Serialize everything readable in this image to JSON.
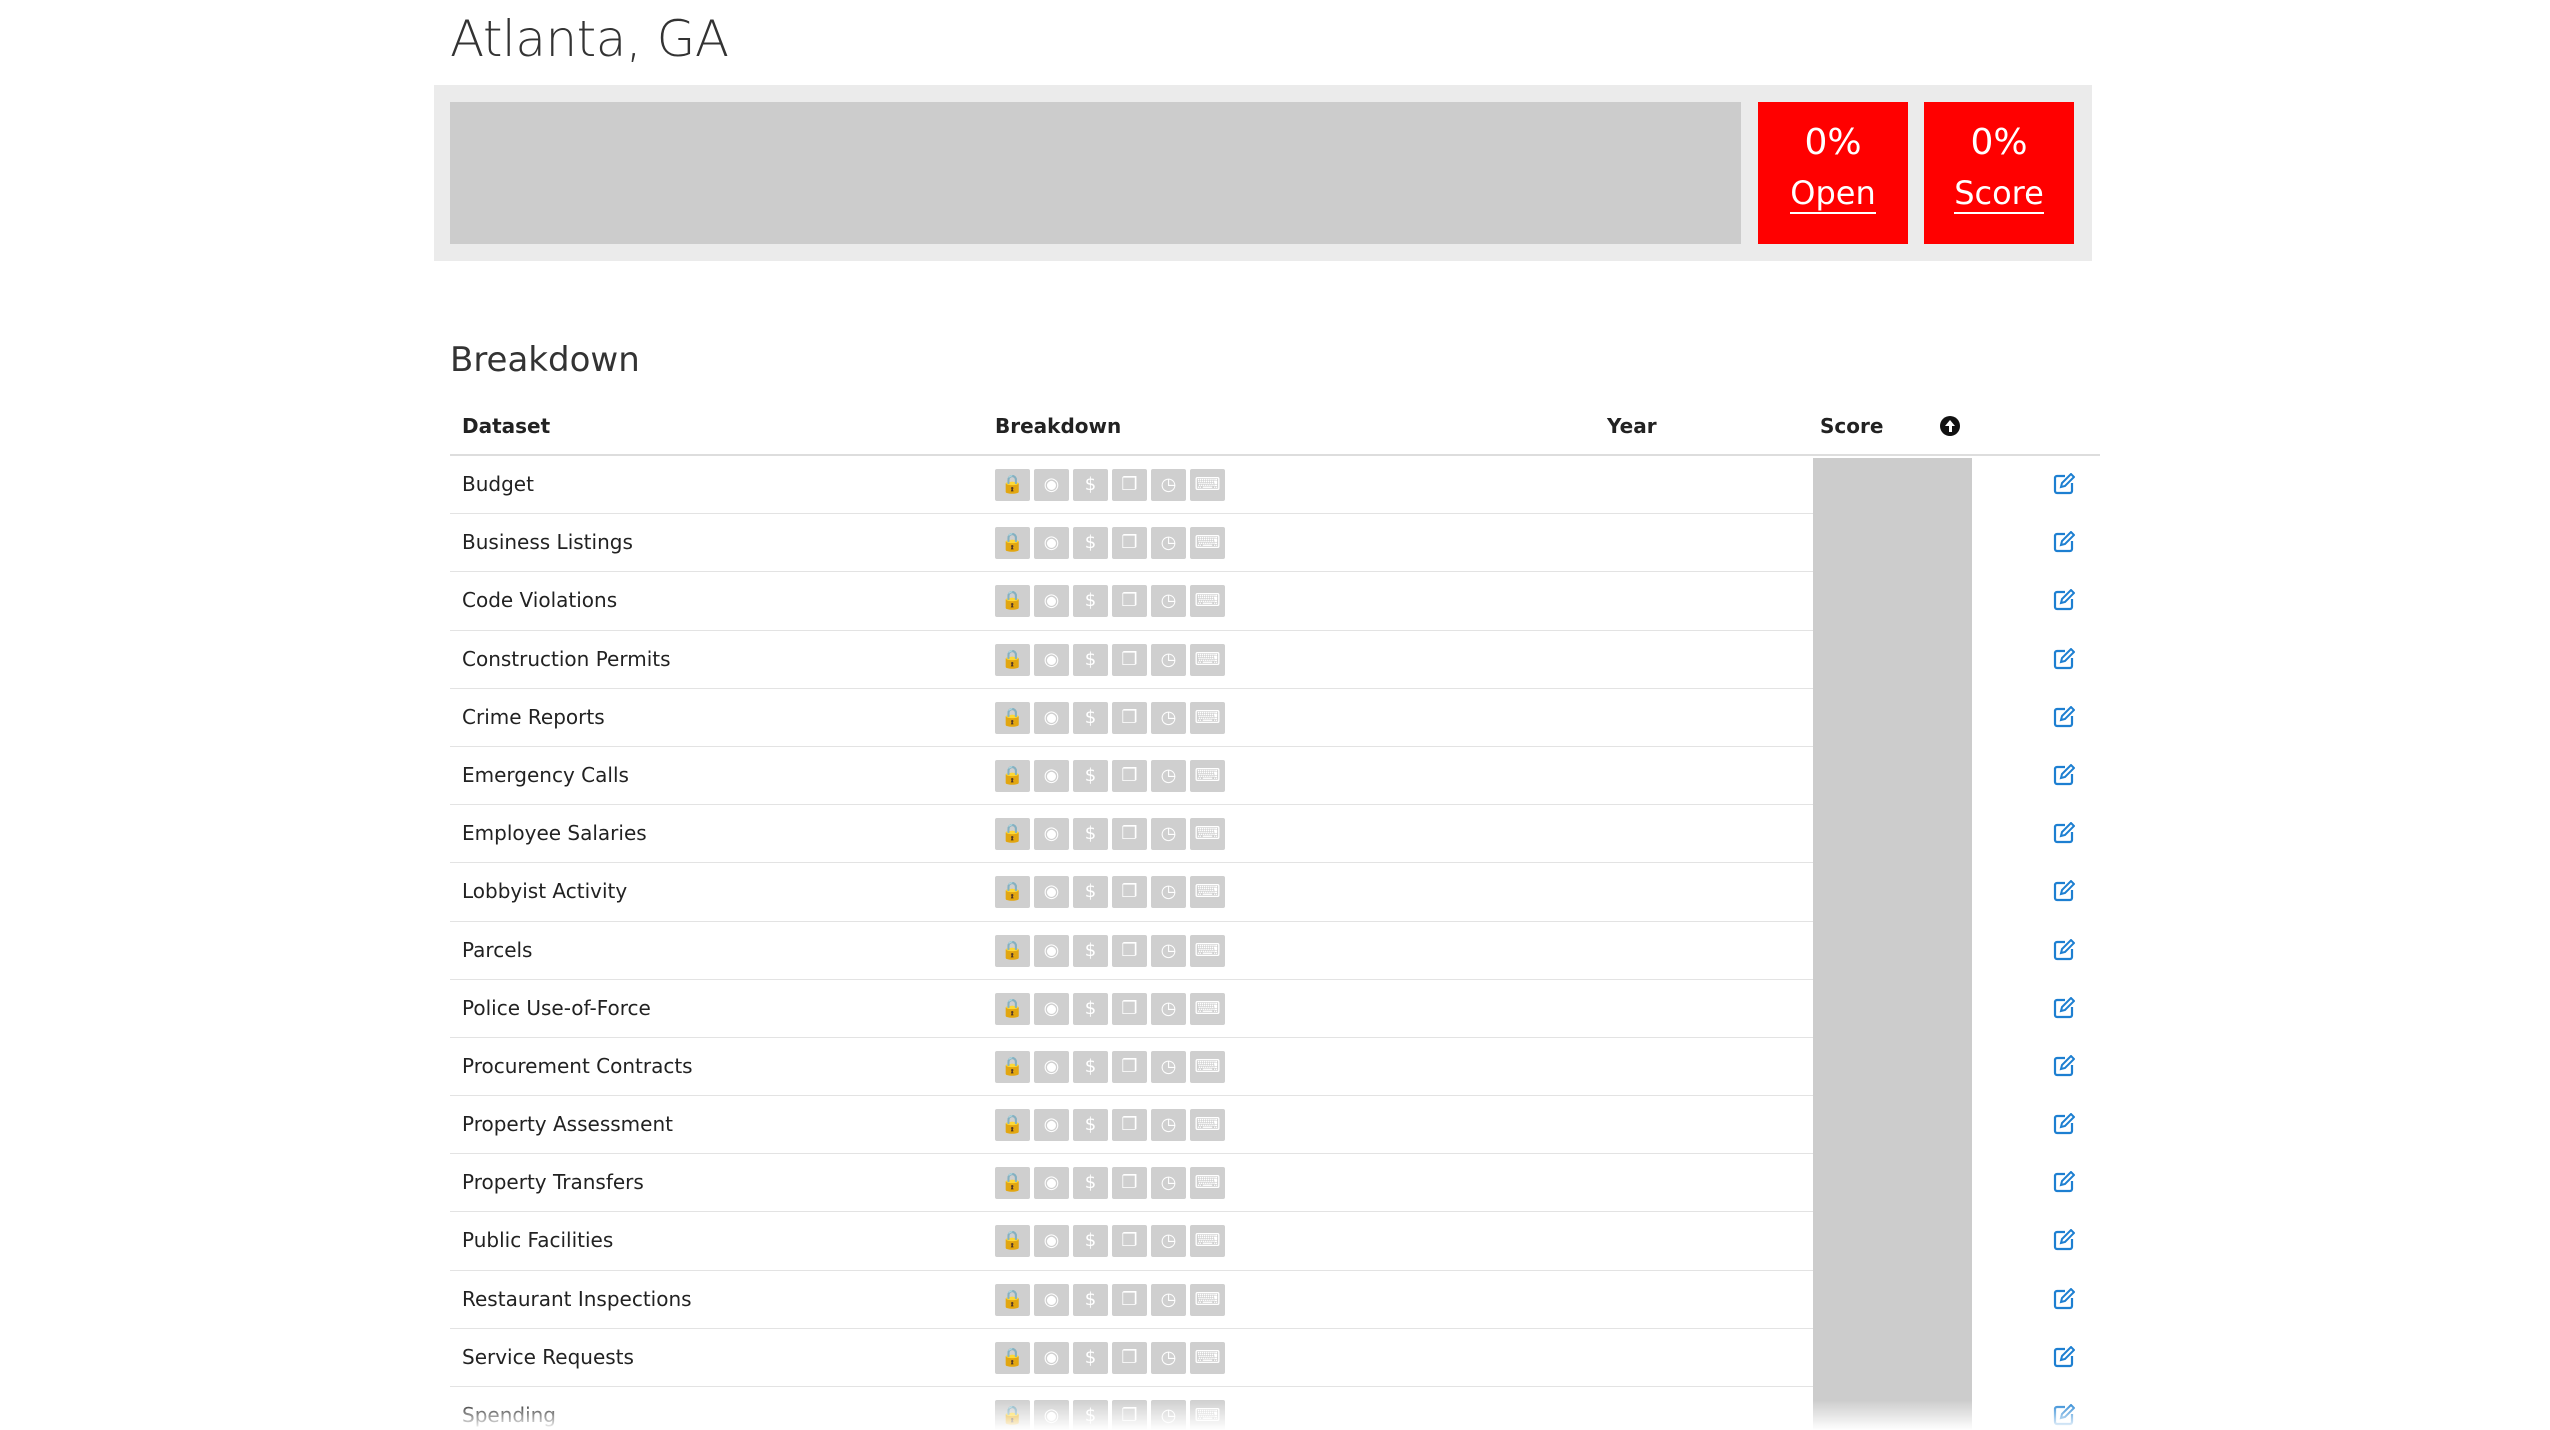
{
  "page": {
    "title": "Atlanta, GA"
  },
  "summary": {
    "open": {
      "value": "0%",
      "label": "Open"
    },
    "score": {
      "value": "0%",
      "label": "Score"
    }
  },
  "breakdown": {
    "section_title": "Breakdown",
    "columns": {
      "dataset": "Dataset",
      "breakdown": "Breakdown",
      "year": "Year",
      "score": "Score"
    },
    "badge_icons": [
      "lock-icon",
      "eye-icon",
      "dollar-icon",
      "copy-icon",
      "clock-icon",
      "keyboard-icon"
    ],
    "rows": [
      {
        "dataset": "Budget",
        "year": ""
      },
      {
        "dataset": "Business Listings",
        "year": ""
      },
      {
        "dataset": "Code Violations",
        "year": ""
      },
      {
        "dataset": "Construction Permits",
        "year": ""
      },
      {
        "dataset": "Crime Reports",
        "year": ""
      },
      {
        "dataset": "Emergency Calls",
        "year": ""
      },
      {
        "dataset": "Employee Salaries",
        "year": ""
      },
      {
        "dataset": "Lobbyist Activity",
        "year": ""
      },
      {
        "dataset": "Parcels",
        "year": ""
      },
      {
        "dataset": "Police Use-of-Force",
        "year": ""
      },
      {
        "dataset": "Procurement Contracts",
        "year": ""
      },
      {
        "dataset": "Property Assessment",
        "year": ""
      },
      {
        "dataset": "Property Transfers",
        "year": ""
      },
      {
        "dataset": "Public Facilities",
        "year": ""
      },
      {
        "dataset": "Restaurant Inspections",
        "year": ""
      },
      {
        "dataset": "Service Requests",
        "year": ""
      },
      {
        "dataset": "Spending",
        "year": ""
      }
    ]
  },
  "colors": {
    "accent_red": "#ff0000",
    "edit_icon_blue": "#1d7fd1",
    "badge_gray": "#cfcfcf",
    "panel_gray": "#cccccc"
  }
}
